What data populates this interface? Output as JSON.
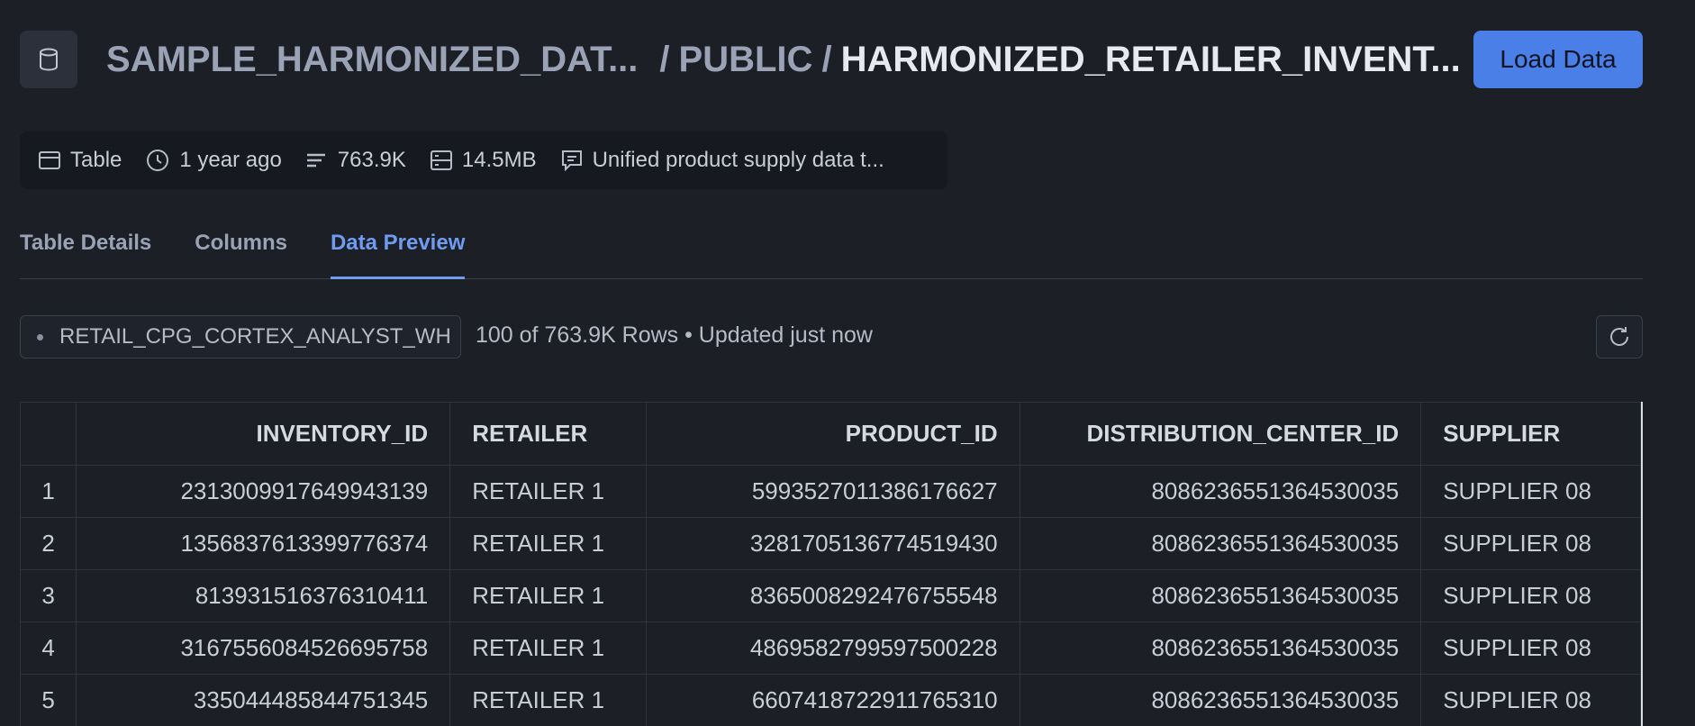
{
  "header": {
    "database": "SAMPLE_HARMONIZED_DAT...",
    "separator": "/",
    "schema": "PUBLIC",
    "table": "HARMONIZED_RETAILER_INVENT...",
    "load_button": "Load Data"
  },
  "meta": {
    "type": "Table",
    "updated": "1 year ago",
    "row_count": "763.9K",
    "size": "14.5MB",
    "comment": "Unified product supply data t..."
  },
  "tabs": [
    {
      "label": "Table Details",
      "active": false
    },
    {
      "label": "Columns",
      "active": false
    },
    {
      "label": "Data Preview",
      "active": true
    }
  ],
  "preview": {
    "warehouse": "RETAIL_CPG_CORTEX_ANALYST_WH",
    "rows_info": "100 of 763.9K Rows • Updated just now"
  },
  "table": {
    "columns": [
      "",
      "INVENTORY_ID",
      "RETAILER",
      "PRODUCT_ID",
      "DISTRIBUTION_CENTER_ID",
      "SUPPLIER"
    ],
    "rows": [
      [
        "1",
        "2313009917649943139",
        "RETAILER 1",
        "5993527011386176627",
        "8086236551364530035",
        "SUPPLIER 08"
      ],
      [
        "2",
        "1356837613399776374",
        "RETAILER 1",
        "3281705136774519430",
        "8086236551364530035",
        "SUPPLIER 08"
      ],
      [
        "3",
        "813931516376310411",
        "RETAILER 1",
        "8365008292476755548",
        "8086236551364530035",
        "SUPPLIER 08"
      ],
      [
        "4",
        "3167556084526695758",
        "RETAILER 1",
        "4869582799597500228",
        "8086236551364530035",
        "SUPPLIER 08"
      ],
      [
        "5",
        "335044485844751345",
        "RETAILER 1",
        "6607418722911765310",
        "8086236551364530035",
        "SUPPLIER 08"
      ]
    ]
  },
  "colors": {
    "background": "#1c1f26",
    "accent": "#4a7fe8",
    "active_tab": "#6f9bf0"
  },
  "icons": {
    "database": "database-icon",
    "table": "table-icon",
    "clock": "clock-icon",
    "rows": "rows-icon",
    "storage": "storage-icon",
    "comment": "comment-icon",
    "refresh": "refresh-icon"
  }
}
